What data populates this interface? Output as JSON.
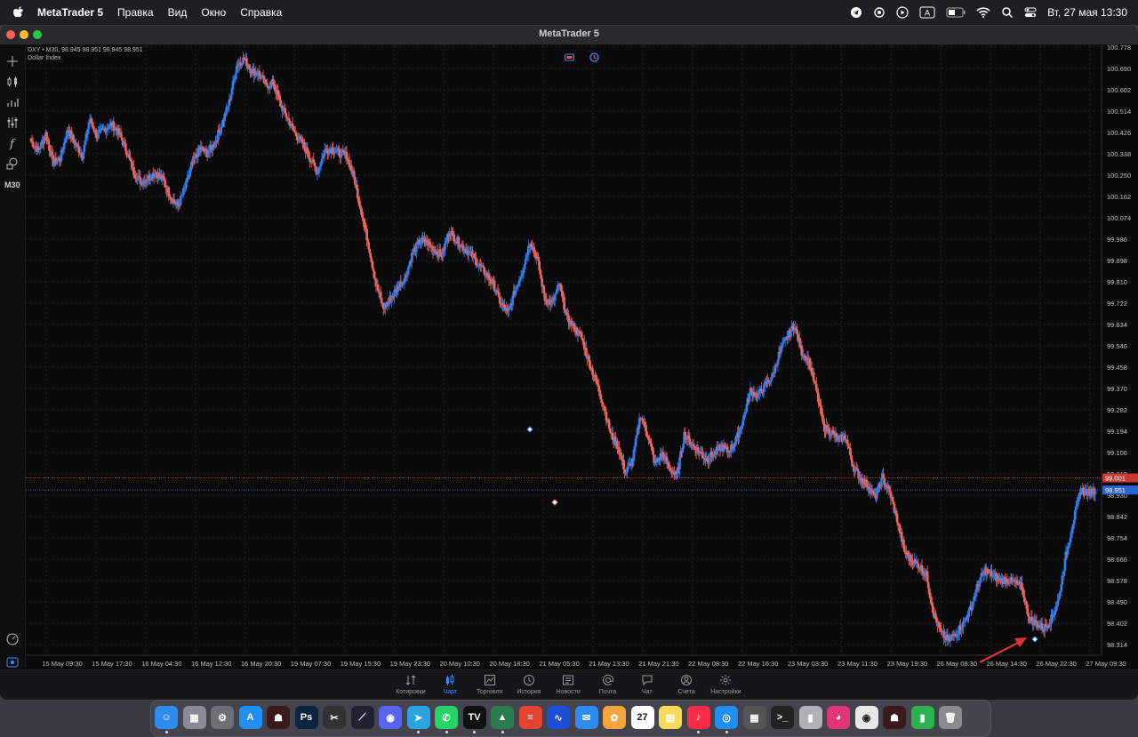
{
  "menubar": {
    "app_name": "MetaTrader 5",
    "menus": [
      "Правка",
      "Вид",
      "Окно",
      "Справка"
    ],
    "clock": "Вт, 27 мая  13:30",
    "status_icons": [
      "telegram-icon",
      "chatgpt-icon",
      "play-icon",
      "keyboard-a-icon",
      "battery-icon",
      "wifi-icon",
      "search-icon",
      "control-center-icon"
    ]
  },
  "window": {
    "title": "MetaTrader 5"
  },
  "symbol": {
    "line1": "DXY • M30, 98.945 98.951 98.945 98.951",
    "line2": "Dollar Index"
  },
  "toolbar": {
    "timeframe": "M30",
    "icons": [
      "crosshair-icon",
      "candles-icon",
      "bars-icon",
      "indicators-icon",
      "function-icon",
      "objects-icon"
    ]
  },
  "colors": {
    "bull": "#2f7ff0",
    "bear": "#f0665d",
    "grid": "#1f1f23",
    "background": "#0a0a0a",
    "price_line_red": "#e34b3b",
    "price_line_blue": "#2e6fd6",
    "axis_text": "#bfbfbf",
    "arrow": "#e0342f"
  },
  "chart_data": {
    "type": "candlestick",
    "symbol": "DXY",
    "timeframe": "M30",
    "ylim": [
      98.27,
      100.77
    ],
    "y_ticks": [
      "100.778",
      "100.690",
      "100.602",
      "100.514",
      "100.426",
      "100.338",
      "100.250",
      "100.162",
      "100.074",
      "99.986",
      "99.898",
      "99.810",
      "99.722",
      "99.634",
      "99.546",
      "99.458",
      "99.370",
      "99.282",
      "99.194",
      "99.106",
      "99.018",
      "98.930",
      "98.842",
      "98.754",
      "98.666",
      "98.578",
      "98.490",
      "98.402",
      "98.314"
    ],
    "x_ticks": [
      "15 May 09:30",
      "15 May 17:30",
      "16 May 04:30",
      "16 May 12:30",
      "16 May 20:30",
      "19 May 07:30",
      "19 May 15:30",
      "19 May 23:30",
      "20 May 10:30",
      "20 May 18:30",
      "21 May 05:30",
      "21 May 13:30",
      "21 May 21:30",
      "22 May 08:30",
      "22 May 16:30",
      "23 May 03:30",
      "23 May 11:30",
      "23 May 19:30",
      "26 May 08:30",
      "26 May 14:30",
      "26 May 22:30",
      "27 May 09:30"
    ],
    "price_labels": {
      "red_line": "99.001",
      "blue_line": "98.951"
    },
    "red_line_value": 99.001,
    "blue_line_value": 98.951,
    "path": [
      100.39,
      100.35,
      100.42,
      100.3,
      100.32,
      100.44,
      100.38,
      100.33,
      100.48,
      100.41,
      100.44,
      100.46,
      100.42,
      100.35,
      100.26,
      100.22,
      100.24,
      100.26,
      100.23,
      100.16,
      100.12,
      100.2,
      100.3,
      100.36,
      100.34,
      100.38,
      100.46,
      100.55,
      100.7,
      100.73,
      100.68,
      100.67,
      100.62,
      100.63,
      100.54,
      100.48,
      100.42,
      100.38,
      100.32,
      100.26,
      100.35,
      100.36,
      100.34,
      100.33,
      100.24,
      100.1,
      99.96,
      99.8,
      99.7,
      99.74,
      99.79,
      99.83,
      99.93,
      99.98,
      99.97,
      99.94,
      99.92,
      100.02,
      99.98,
      99.95,
      99.92,
      99.88,
      99.84,
      99.8,
      99.72,
      99.68,
      99.78,
      99.86,
      99.98,
      99.9,
      99.74,
      99.72,
      99.8,
      99.66,
      99.62,
      99.58,
      99.48,
      99.4,
      99.3,
      99.18,
      99.13,
      99.02,
      99.08,
      99.26,
      99.18,
      99.06,
      99.1,
      99.04,
      99.01,
      99.18,
      99.14,
      99.11,
      99.08,
      99.1,
      99.13,
      99.11,
      99.15,
      99.24,
      99.36,
      99.34,
      99.38,
      99.42,
      99.52,
      99.58,
      99.63,
      99.52,
      99.48,
      99.36,
      99.21,
      99.19,
      99.16,
      99.17,
      99.05,
      99.0,
      98.97,
      98.92,
      99.0,
      98.94,
      98.83,
      98.7,
      98.66,
      98.64,
      98.6,
      98.44,
      98.36,
      98.33,
      98.36,
      98.4,
      98.46,
      98.56,
      98.62,
      98.6,
      98.58,
      98.58,
      98.57,
      98.55,
      98.42,
      98.4,
      98.38,
      98.42,
      98.5,
      98.68,
      98.82,
      98.95,
      98.94,
      98.95
    ]
  },
  "annotations": [
    {
      "type": "arrow",
      "description": "red arrow pointing to a marker near 26 May 22:30"
    }
  ],
  "bottom_tabs": [
    {
      "label": "Котировки",
      "icon": "quotes-icon",
      "active": false
    },
    {
      "label": "Чарт",
      "icon": "chart-icon",
      "active": true
    },
    {
      "label": "Торговля",
      "icon": "trade-icon",
      "active": false
    },
    {
      "label": "История",
      "icon": "history-icon",
      "active": false
    },
    {
      "label": "Новости",
      "icon": "news-icon",
      "active": false
    },
    {
      "label": "Почта",
      "icon": "mail-icon",
      "active": false
    },
    {
      "label": "Чат",
      "icon": "chat-icon",
      "active": false
    },
    {
      "label": "Счета",
      "icon": "accounts-icon",
      "active": false
    },
    {
      "label": "Настройки",
      "icon": "settings-icon",
      "active": false
    }
  ],
  "dock": {
    "apps": [
      {
        "name": "finder-icon",
        "color": "#2f8cf2",
        "glyph": "☺"
      },
      {
        "name": "launchpad-icon",
        "color": "#8a8a96",
        "glyph": "▦"
      },
      {
        "name": "system-settings-icon",
        "color": "#6e6e76",
        "glyph": "⚙"
      },
      {
        "name": "app-store-icon",
        "color": "#1f8ef5",
        "glyph": "A"
      },
      {
        "name": "game-icon",
        "color": "#3a1a1a",
        "glyph": "☗"
      },
      {
        "name": "photoshop-icon",
        "color": "#0b2540",
        "glyph": "Ps"
      },
      {
        "name": "final-cut-icon",
        "color": "#333",
        "glyph": "✂"
      },
      {
        "name": "tradingview-pro-icon",
        "color": "#223",
        "glyph": "⟋"
      },
      {
        "name": "discord-icon",
        "color": "#5865f2",
        "glyph": "◉"
      },
      {
        "name": "telegram-icon",
        "color": "#2aa3e0",
        "glyph": "➤"
      },
      {
        "name": "whatsapp-icon",
        "color": "#25d366",
        "glyph": "✆"
      },
      {
        "name": "tradingview-icon",
        "color": "#111",
        "glyph": "TV"
      },
      {
        "name": "metatrader-icon",
        "color": "#2a7d4f",
        "glyph": "▲"
      },
      {
        "name": "todoist-icon",
        "color": "#e44332",
        "glyph": "≡"
      },
      {
        "name": "stocks-icon",
        "color": "#1d4ed8",
        "glyph": "∿"
      },
      {
        "name": "mail-icon",
        "color": "#2f8cf2",
        "glyph": "✉"
      },
      {
        "name": "photos-icon",
        "color": "#f4a53b",
        "glyph": "✿"
      },
      {
        "name": "calendar-icon",
        "color": "#ffffff",
        "glyph": "27"
      },
      {
        "name": "notes-icon",
        "color": "#f7d95c",
        "glyph": "▤"
      },
      {
        "name": "music-icon",
        "color": "#fa2d48",
        "glyph": "♪"
      },
      {
        "name": "safari-icon",
        "color": "#1f8ef5",
        "glyph": "◎"
      },
      {
        "name": "calculator-icon",
        "color": "#555",
        "glyph": "▦"
      },
      {
        "name": "terminal-icon",
        "color": "#222",
        "glyph": ">_"
      },
      {
        "name": "preview-icon",
        "color": "#b0b0b8",
        "glyph": "▮"
      },
      {
        "name": "robot-icon",
        "color": "#e2347a",
        "glyph": "◕"
      },
      {
        "name": "chrome-icon",
        "color": "#e8e8e8",
        "glyph": "◉"
      },
      {
        "name": "game2-icon",
        "color": "#3a1a1a",
        "glyph": "☗"
      },
      {
        "name": "numbers-icon",
        "color": "#2bb24c",
        "glyph": "▮"
      },
      {
        "name": "trash-icon",
        "color": "#8a8a90",
        "glyph": "🗑"
      }
    ]
  }
}
